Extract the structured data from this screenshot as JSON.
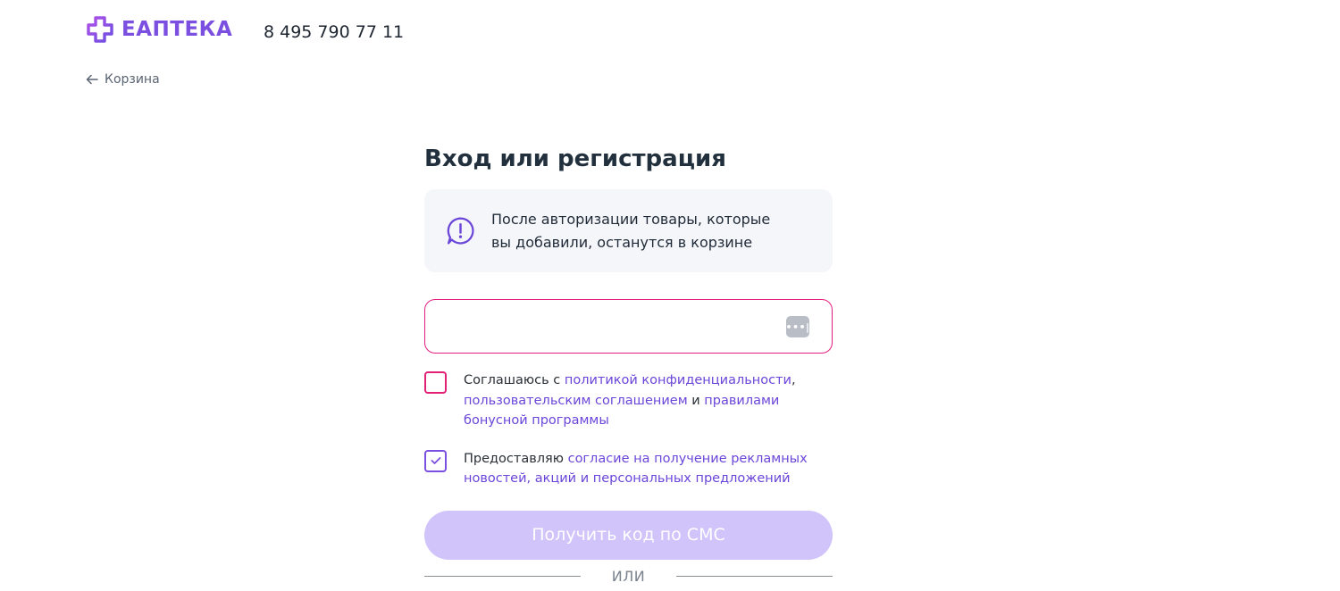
{
  "header": {
    "logo_text": "ЕАПТЕКА",
    "phone": "8 495 790 77 11"
  },
  "back_link": {
    "label": "Корзина"
  },
  "form": {
    "title": "Вход или регистрация",
    "info_line1": "После авторизации товары, которые",
    "info_line2": "вы добавили, останутся в корзине",
    "phone_input": {
      "value": "",
      "placeholder": ""
    },
    "autofill_glyph": "•••|",
    "consent": {
      "prefix": "Соглашаюсь с ",
      "privacy_link": "политикой конфиденциальности",
      "comma": ",",
      "agreement_link": "пользовательским соглашением",
      "and": " и ",
      "bonus_link_line1": "правилами",
      "bonus_link_line2": "бонусной программы",
      "checked": false
    },
    "marketing": {
      "prefix": "Предоставляю ",
      "link_line1": "согласие на получение рекламных",
      "link_line2": "новостей, акций и персональных предложений",
      "checked": true
    },
    "submit_label": "Получить код по СМС",
    "divider_label": "ИЛИ"
  },
  "colors": {
    "brand": "#7b4fe0",
    "error_border": "#e21d80",
    "link": "#6b46d9",
    "button_disabled": "#d0c4fa",
    "info_bg": "#f5f6fa"
  },
  "icons": {
    "logo": "pharmacy-cross-icon",
    "back": "arrow-left-icon",
    "info": "exclamation-speech-bubble-icon",
    "autofill": "password-autofill-icon",
    "checked": "checkmark-icon"
  }
}
